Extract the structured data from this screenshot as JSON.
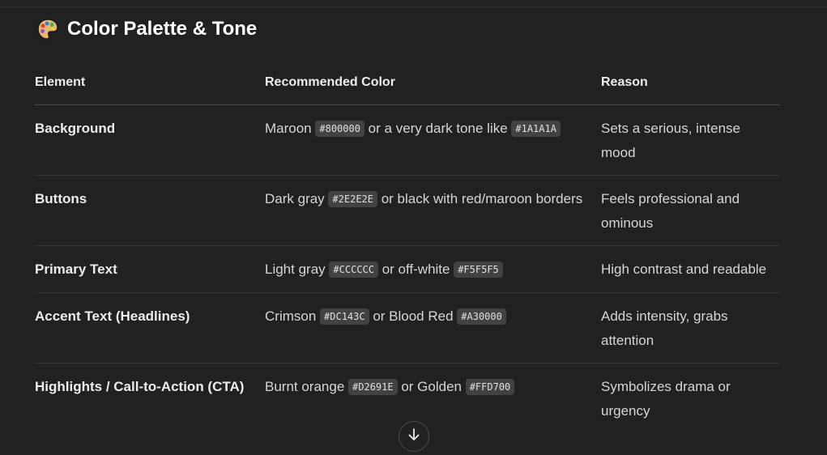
{
  "section": {
    "icon": "artist-palette-icon",
    "title": "Color Palette & Tone"
  },
  "table": {
    "headers": [
      "Element",
      "Recommended Color",
      "Reason"
    ],
    "rows": [
      {
        "element": "Background",
        "color_parts": [
          "Maroon ",
          "#800000",
          " or a very dark tone like ",
          "#1A1A1A"
        ],
        "reason": "Sets a serious, intense mood"
      },
      {
        "element": "Buttons",
        "color_parts": [
          "Dark gray ",
          "#2E2E2E",
          " or black with red/maroon borders"
        ],
        "reason": "Feels professional and ominous"
      },
      {
        "element": "Primary Text",
        "color_parts": [
          "Light gray ",
          "#CCCCCC",
          " or off-white ",
          "#F5F5F5"
        ],
        "reason": "High contrast and readable"
      },
      {
        "element": "Accent Text (Headlines)",
        "color_parts": [
          "Crimson ",
          "#DC143C",
          " or Blood Red ",
          "#A30000"
        ],
        "reason": "Adds intensity, grabs attention"
      },
      {
        "element": "Highlights / Call-to-Action (CTA)",
        "color_parts": [
          "Burnt orange ",
          "#D2691E",
          " or Golden ",
          "#FFD700"
        ],
        "reason": "Symbolizes drama or urgency"
      }
    ]
  },
  "controls": {
    "scroll_down_icon": "arrow-down-icon"
  },
  "colors": {
    "page_background": "#212121",
    "code_background": "#424242",
    "divider": "#333333"
  }
}
